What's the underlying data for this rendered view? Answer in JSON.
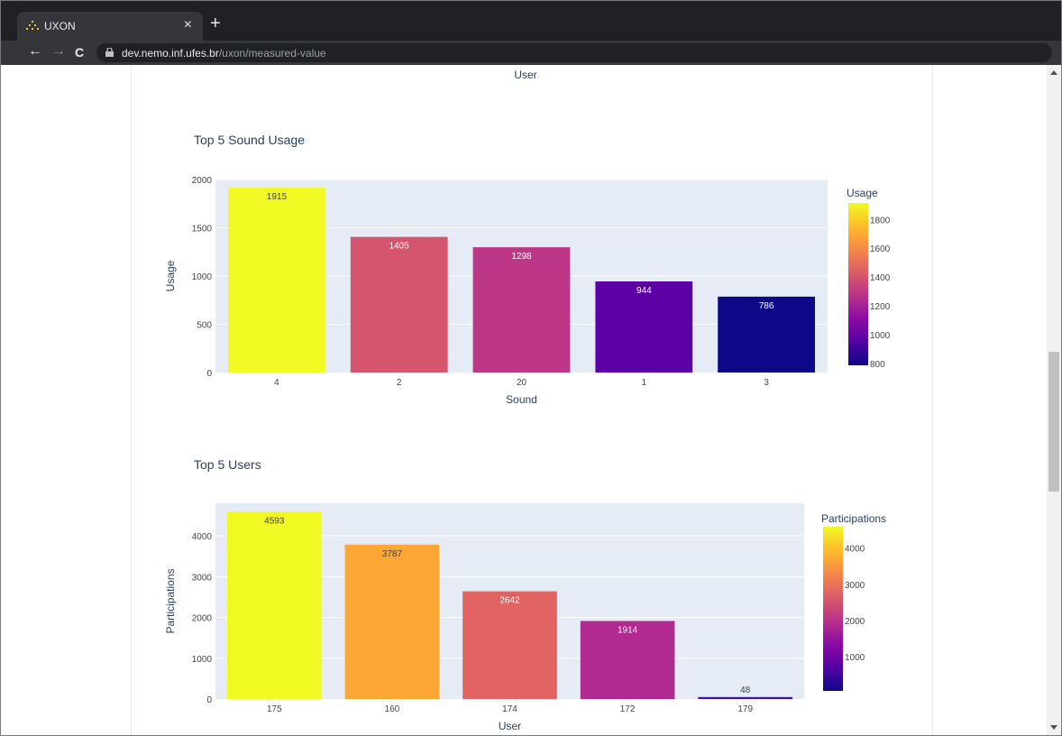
{
  "browser": {
    "tab_title": "UXON",
    "close_icon": "×",
    "new_tab_icon": "+",
    "back_icon": "←",
    "forward_icon": "→",
    "reload_icon": "C",
    "url_host": "dev.nemo.inf.ufes.br",
    "url_path": "/uxon/measured-value"
  },
  "page": {
    "prev_chart_xlabel": "User"
  },
  "chart_data": [
    {
      "type": "bar",
      "title": "Top 5 Sound Usage",
      "xlabel": "Sound",
      "ylabel": "Usage",
      "categories": [
        "4",
        "2",
        "20",
        "1",
        "3"
      ],
      "values": [
        1915,
        1405,
        1298,
        944,
        786
      ],
      "ylim": [
        0,
        2000
      ],
      "yticks": [
        0,
        500,
        1000,
        1500,
        2000
      ],
      "colorbar": {
        "title": "Usage",
        "range": [
          786,
          1915
        ],
        "ticks": [
          800,
          1000,
          1200,
          1400,
          1600,
          1800
        ]
      },
      "colors": [
        "#f0f921",
        "#d5546e",
        "#bd3786",
        "#5d01a6",
        "#0d0887"
      ],
      "label_colors": [
        "#444444",
        "#ffffff",
        "#ffffff",
        "#ffffff",
        "#ffffff"
      ],
      "grid": true
    },
    {
      "type": "bar",
      "title": "Top 5 Users",
      "xlabel": "User",
      "ylabel": "Participations",
      "categories": [
        "175",
        "160",
        "174",
        "172",
        "179"
      ],
      "values": [
        4593,
        3787,
        2642,
        1914,
        48
      ],
      "ylim": [
        0,
        4800
      ],
      "yticks": [
        0,
        1000,
        2000,
        3000,
        4000
      ],
      "colorbar": {
        "title": "Participations",
        "range": [
          48,
          4593
        ],
        "ticks": [
          1000,
          2000,
          3000,
          4000
        ]
      },
      "colors": [
        "#f0f921",
        "#fca636",
        "#e16462",
        "#b12a90",
        "#3a0ad0"
      ],
      "label_colors": [
        "#444444",
        "#444444",
        "#ffffff",
        "#ffffff",
        "#444444"
      ],
      "grid": true
    }
  ]
}
